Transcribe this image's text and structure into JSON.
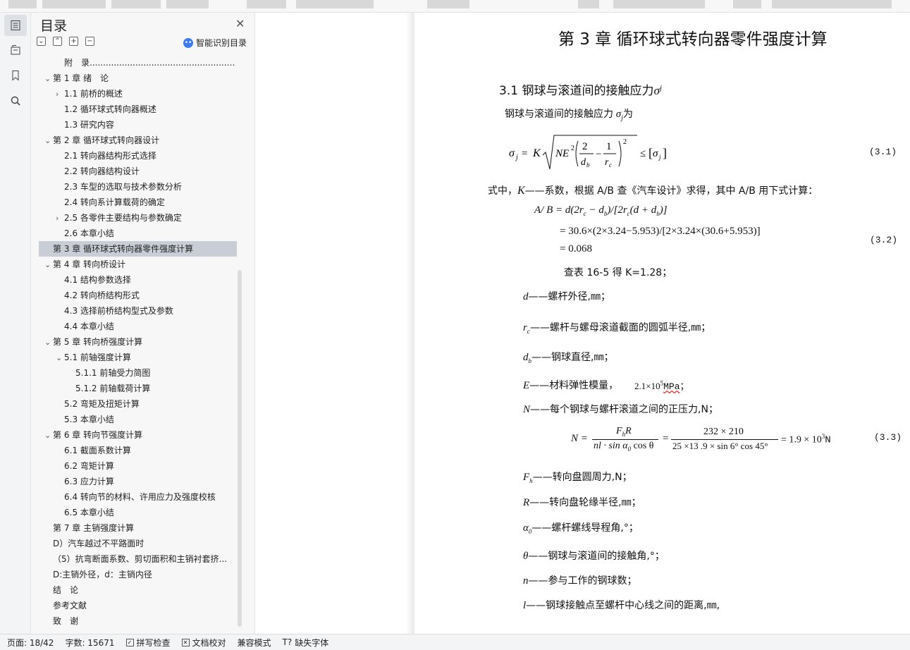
{
  "toc": {
    "title": "目录",
    "smart_label": "智能识别目录",
    "items": [
      {
        "label": "附　录.........................................................................",
        "level": 1,
        "arrow": ""
      },
      {
        "label": "第 1 章  绪　论",
        "level": 0,
        "arrow": "v"
      },
      {
        "label": "1.1 前桥的概述",
        "level": 1,
        "arrow": ">"
      },
      {
        "label": "1.2 循环球式转向器概述",
        "level": 1,
        "arrow": ""
      },
      {
        "label": "1.3 研究内容",
        "level": 1,
        "arrow": ""
      },
      {
        "label": "第 2 章  循环球式转向器设计",
        "level": 0,
        "arrow": "v"
      },
      {
        "label": "2.1 转向器结构形式选择",
        "level": 1,
        "arrow": ""
      },
      {
        "label": "2.2 转向器结构设计",
        "level": 1,
        "arrow": ""
      },
      {
        "label": "2.3 车型的选取与技术参数分析",
        "level": 1,
        "arrow": ""
      },
      {
        "label": "2.4 转向系计算载荷的确定",
        "level": 1,
        "arrow": ""
      },
      {
        "label": "2.5 各零件主要结构与参数确定",
        "level": 1,
        "arrow": ">"
      },
      {
        "label": "2.6 本章小结",
        "level": 1,
        "arrow": ""
      },
      {
        "label": "第 3 章  循环球式转向器零件强度计算",
        "level": 0,
        "arrow": "",
        "selected": true
      },
      {
        "label": "第 4 章  转向桥设计",
        "level": 0,
        "arrow": "v"
      },
      {
        "label": "4.1 结构参数选择",
        "level": 1,
        "arrow": ""
      },
      {
        "label": "4.2 转向桥结构形式",
        "level": 1,
        "arrow": ""
      },
      {
        "label": "4.3 选择前桥结构型式及参数",
        "level": 1,
        "arrow": ""
      },
      {
        "label": "4.4 本章小结",
        "level": 1,
        "arrow": ""
      },
      {
        "label": "第 5 章  转向桥强度计算",
        "level": 0,
        "arrow": "v"
      },
      {
        "label": "5.1 前轴强度计算",
        "level": 1,
        "arrow": "v"
      },
      {
        "label": "5.1.1 前轴受力简图",
        "level": 2,
        "arrow": ""
      },
      {
        "label": "5.1.2 前轴载荷计算",
        "level": 2,
        "arrow": ""
      },
      {
        "label": "5.2 弯矩及扭矩计算",
        "level": 1,
        "arrow": ""
      },
      {
        "label": "5.3 本章小结",
        "level": 1,
        "arrow": ""
      },
      {
        "label": "第 6 章  转向节强度计算",
        "level": 0,
        "arrow": "v"
      },
      {
        "label": "6.1 截面系数计算",
        "level": 1,
        "arrow": ""
      },
      {
        "label": "6.2 弯矩计算",
        "level": 1,
        "arrow": ""
      },
      {
        "label": "6.3 应力计算",
        "level": 1,
        "arrow": ""
      },
      {
        "label": "6.4 转向节的材料、许用应力及强度校核",
        "level": 1,
        "arrow": ""
      },
      {
        "label": "6.5 本章小结",
        "level": 1,
        "arrow": ""
      },
      {
        "label": "第 7 章  主销强度计算",
        "level": 0,
        "arrow": ""
      },
      {
        "label": "D）汽车越过不平路面时",
        "level": 0,
        "arrow": ""
      },
      {
        "label": "（5）抗弯断面系数、剪切面积和主销衬套挤...",
        "level": 0,
        "arrow": ""
      },
      {
        "label": "D:主销外径，d：主销内径",
        "level": 0,
        "arrow": ""
      },
      {
        "label": "结　论",
        "level": 0,
        "arrow": ""
      },
      {
        "label": "参考文献",
        "level": 0,
        "arrow": ""
      },
      {
        "label": "致　谢",
        "level": 0,
        "arrow": ""
      }
    ]
  },
  "doc": {
    "chapter_title": "第 3 章  循环球式转向器零件强度计算",
    "section_title": "3.1 钢球与滚道间的接触应力",
    "section_sym": "σ",
    "section_sub": "j",
    "intro_text": "钢球与滚道间的接触应力",
    "intro_sym": "σ",
    "intro_sub": "j",
    "intro_tail": "为",
    "eq1_num": "(3.1)",
    "where_prefix": "式中，",
    "where_K": "K",
    "where_text": "——系数，根据 A/B 查《汽车设计》求得，其中 A/B 用下式计算：",
    "eq2_line1": "A/ B = d(2r",
    "eq2_line2": "= 30.6×(2×3.24−5.953)/[2×3.24×(30.6+5.953)]",
    "eq2_line3": "= 0.068",
    "eq2_num": "(3.2)",
    "lookup_text": "查表 16-5 得 K=1.28；",
    "defs": [
      {
        "sym": "d",
        "sub": "",
        "text": "——螺杆外径,㎜；"
      },
      {
        "sym": "r",
        "sub": "c",
        "text": "——螺杆与螺母滚道截面的圆弧半径,㎜；"
      },
      {
        "sym": "d",
        "sub": "b",
        "text": "——钢球直径,㎜；"
      },
      {
        "sym": "E",
        "sub": "",
        "text": "——材料弹性模量，"
      },
      {
        "sym": "N",
        "sub": "",
        "text": "——每个钢球与螺杆滚道之间的正压力,N；"
      }
    ],
    "modulus_value": "2.1×10",
    "modulus_exp": "5",
    "modulus_unit": "MPa",
    "modulus_tail": "；",
    "eq3_lhs": "N =",
    "eq3_num_top": "F",
    "eq3_num_sub": "h",
    "eq3_num_R": "R",
    "eq3_den": "nl · sin α",
    "eq3_den_tail": " cos θ",
    "eq3_mid_top": "232 × 210",
    "eq3_mid_bot": "25 ×13 .9 × sin 6° cos 45°",
    "eq3_result": "= 1.9 × 10",
    "eq3_exp": "3",
    "eq3_unit": "N",
    "eq3_number": "(3.3)",
    "defs2": [
      {
        "sym": "F",
        "sub": "h",
        "text": "——转向盘圆周力,N；"
      },
      {
        "sym": "R",
        "sub": "",
        "text": "——转向盘轮缘半径,㎜；"
      },
      {
        "sym": "α",
        "sub": "0",
        "text": "——螺杆螺线导程角,°；"
      },
      {
        "sym": "θ",
        "sub": "",
        "text": "——钢球与滚道间的接触角,°；"
      },
      {
        "sym": "n",
        "sub": "",
        "text": "——参与工作的钢球数；"
      },
      {
        "sym": "l",
        "sub": "",
        "text": "——钢球接触点至螺杆中心线之间的距离,㎜,"
      }
    ]
  },
  "status": {
    "page": "页面: 18/42",
    "words": "字数: 15671",
    "spell": "拼写检查",
    "proof": "文档校对",
    "compat": "兼容模式",
    "missing_font": "缺失字体"
  }
}
